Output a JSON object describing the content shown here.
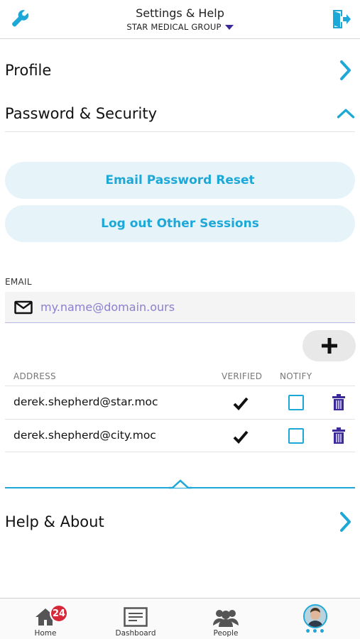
{
  "header": {
    "title": "Settings & Help",
    "org": "STAR MEDICAL GROUP",
    "left_icon": "wrench-icon",
    "right_icon": "logout-icon"
  },
  "sections": {
    "profile": "Profile",
    "security": "Password & Security",
    "help": "Help & About"
  },
  "security": {
    "reset_button": "Email Password Reset",
    "logout_button": "Log out Other Sessions",
    "email_label": "EMAIL",
    "email_placeholder": "my.name@domain.ours",
    "add_button_icon": "plus-icon",
    "columns": {
      "address": "ADDRESS",
      "verified": "VERIFIED",
      "notify": "NOTIFY"
    },
    "emails": [
      {
        "address": "derek.shepherd@star.moc",
        "verified": true,
        "notify": false
      },
      {
        "address": "derek.shepherd@city.moc",
        "verified": true,
        "notify": false
      }
    ]
  },
  "tabs": {
    "home": {
      "label": "Home",
      "badge": "24"
    },
    "dashboard": {
      "label": "Dashboard"
    },
    "people": {
      "label": "People"
    },
    "profile": {
      "label": "•••"
    }
  },
  "colors": {
    "accent": "#1ea8d8",
    "accent_light": "#e6f4fa",
    "dark_purple": "#3a2a9a",
    "badge_red": "#d7283a"
  }
}
